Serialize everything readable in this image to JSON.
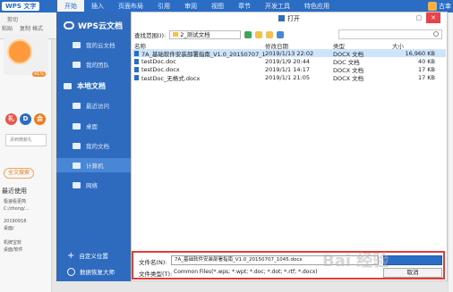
{
  "wps": {
    "app_button": "WPS 文字",
    "tabs": [
      "开始",
      "插入",
      "页面布局",
      "引用",
      "审阅",
      "视图",
      "章节",
      "开发工具",
      "特色应用"
    ],
    "user": "古幸",
    "ribbon": {
      "cut": "剪切",
      "paste": "粘贴",
      "copy": "复制",
      "format": "格式"
    },
    "profile_percent": "41%",
    "circle_buttons": [
      "礼",
      "D",
      "会"
    ],
    "side_input": "添到微薪礼",
    "pill": "全文搜索",
    "recent_title": "最近使用",
    "recent_items": [
      {
        "title": "极速看更简",
        "path": "C:/zhong/..."
      },
      {
        "title": "20190918",
        "path": "桌面/"
      },
      {
        "title": "机牌宝软",
        "path": "桌面/软件"
      }
    ]
  },
  "dialog": {
    "title": "打开",
    "sidebar": {
      "cloud": "WPS云文档",
      "cloud_items": [
        "我的云文档",
        "我的团队"
      ],
      "local": "本地文档",
      "local_items": [
        "最近访问",
        "桌面",
        "我的文档",
        "计算机",
        "网络"
      ],
      "selected": "计算机",
      "bottom": [
        "自定义位置",
        "数据恢复大师"
      ]
    },
    "look_in_label": "查找范围(I):",
    "look_in_value": "2_测试文档",
    "columns": [
      "名称",
      "修改日期",
      "类型",
      "大小"
    ],
    "files": [
      {
        "name": "7A_基础软件安装部署指南_V1.0_20150707_1045...",
        "date": "2019/1/13 22:02",
        "type": "DOCX 文档",
        "size": "16,960 KB",
        "selected": true
      },
      {
        "name": "testDoc.doc",
        "date": "2019/1/9 20:44",
        "type": "DOC 文档",
        "size": "40 KB",
        "selected": false
      },
      {
        "name": "testDoc.docx",
        "date": "2019/1/1 14:17",
        "type": "DOCX 文档",
        "size": "17 KB",
        "selected": false
      },
      {
        "name": "testDoc_无格式.docx",
        "date": "2019/1/1 21:05",
        "type": "DOCX 文档",
        "size": "17 KB",
        "selected": false
      }
    ],
    "filename_label": "文件名(N):",
    "filename_value": "7A_基础软件安装部署指南_V1.0_20150707_1045.docx",
    "filetype_label": "文件类型(T):",
    "filetype_value": "Common Files(*.wps; *.wpt; *.doc; *.dot; *.rtf; *.docx)",
    "cancel_label": "取消",
    "watermark": "Bai 经验"
  },
  "colors": {
    "accent": "#2b6cc4",
    "sidebar": "#2e6bbf",
    "highlight": "#e03c3c",
    "selected_row": "#cde4fa"
  }
}
